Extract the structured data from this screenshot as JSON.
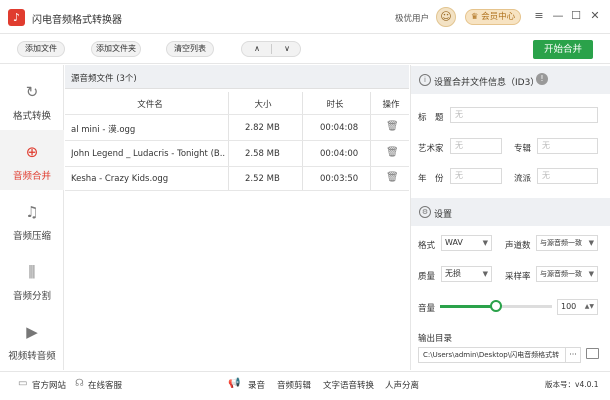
{
  "app": {
    "title": "闪电音频格式转换器",
    "user_name": "极优用户",
    "vip_label": "会员中心"
  },
  "window_controls": {
    "menu": "≡",
    "minimize": "—",
    "maximize": "☐",
    "close": "✕"
  },
  "toolbar": {
    "add_file": "添加文件",
    "add_folder": "添加文件夹",
    "clear_list": "清空列表",
    "move_up": "∧",
    "move_down": "∨",
    "start_merge": "开始合并"
  },
  "sidebar": {
    "items": [
      {
        "label": "格式转换",
        "icon": "refresh-icon"
      },
      {
        "label": "音频合并",
        "icon": "merge-icon",
        "active": true
      },
      {
        "label": "音频压缩",
        "icon": "compress-icon"
      },
      {
        "label": "音频分割",
        "icon": "split-icon"
      },
      {
        "label": "视频转音频",
        "icon": "video-icon"
      }
    ]
  },
  "file_list": {
    "title": "源音频文件 (3个)",
    "columns": {
      "name": "文件名",
      "size": "大小",
      "duration": "时长",
      "action": "操作"
    },
    "rows": [
      {
        "name": "al mini - 漠.ogg",
        "size": "2.82 MB",
        "duration": "00:04:08"
      },
      {
        "name": "John Legend _ Ludacris - Tonight (B...",
        "size": "2.58 MB",
        "duration": "00:04:00"
      },
      {
        "name": "Kesha - Crazy Kids.ogg",
        "size": "2.52 MB",
        "duration": "00:03:50"
      }
    ]
  },
  "id3": {
    "title": "设置合并文件信息（ID3）",
    "title_label": "标　题",
    "artist_label": "艺术家",
    "album_label": "专辑",
    "year_label": "年　份",
    "genre_label": "流派",
    "placeholder": "无"
  },
  "settings": {
    "title": "设置",
    "format_label": "格式",
    "format_value": "WAV",
    "channels_label": "声道数",
    "channels_value": "与源音频一致",
    "quality_label": "质量",
    "quality_value": "无损",
    "samplerate_label": "采样率",
    "samplerate_value": "与源音频一致",
    "volume_label": "音量",
    "volume_value": "100",
    "volume_fraction": 0.5,
    "output_label": "输出目录",
    "output_path": "C:\\Users\\admin\\Desktop\\闪电音频格式转",
    "browse": "···"
  },
  "bottom": {
    "website": "官方网站",
    "support": "在线客服",
    "record": "录音",
    "cut": "音频剪辑",
    "tts": "文字语音转换",
    "dubbing": "人声分离",
    "version": "版本号：v4.0.1"
  }
}
